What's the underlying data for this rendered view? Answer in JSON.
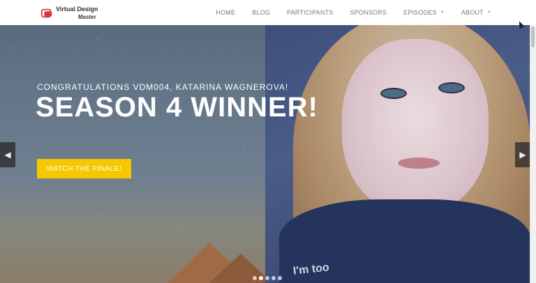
{
  "logo": {
    "line1": "Virtual Design",
    "line2": "Master",
    "icon": "vdm-logo-icon"
  },
  "nav": {
    "items": [
      {
        "label": "HOME",
        "dropdown": false
      },
      {
        "label": "BLOG",
        "dropdown": false
      },
      {
        "label": "PARTICIPANTS",
        "dropdown": false
      },
      {
        "label": "SPONSORS",
        "dropdown": false
      },
      {
        "label": "EPISODES",
        "dropdown": true
      },
      {
        "label": "ABOUT",
        "dropdown": true
      }
    ]
  },
  "hero": {
    "kicker": "CONGRATULATIONS VDM004, KATARINA WAGNEROVA!",
    "headline": "SEASON 4 WINNER!",
    "cta": "WATCH THE FINALE!",
    "shirt_text": "I'm too",
    "prev_icon": "chevron-left-icon",
    "next_icon": "chevron-right-icon",
    "slides": 5,
    "active_slide": 2
  },
  "colors": {
    "accent": "#f5c800",
    "brand": "#d03a3a",
    "nav_text": "#7a7a7a"
  }
}
